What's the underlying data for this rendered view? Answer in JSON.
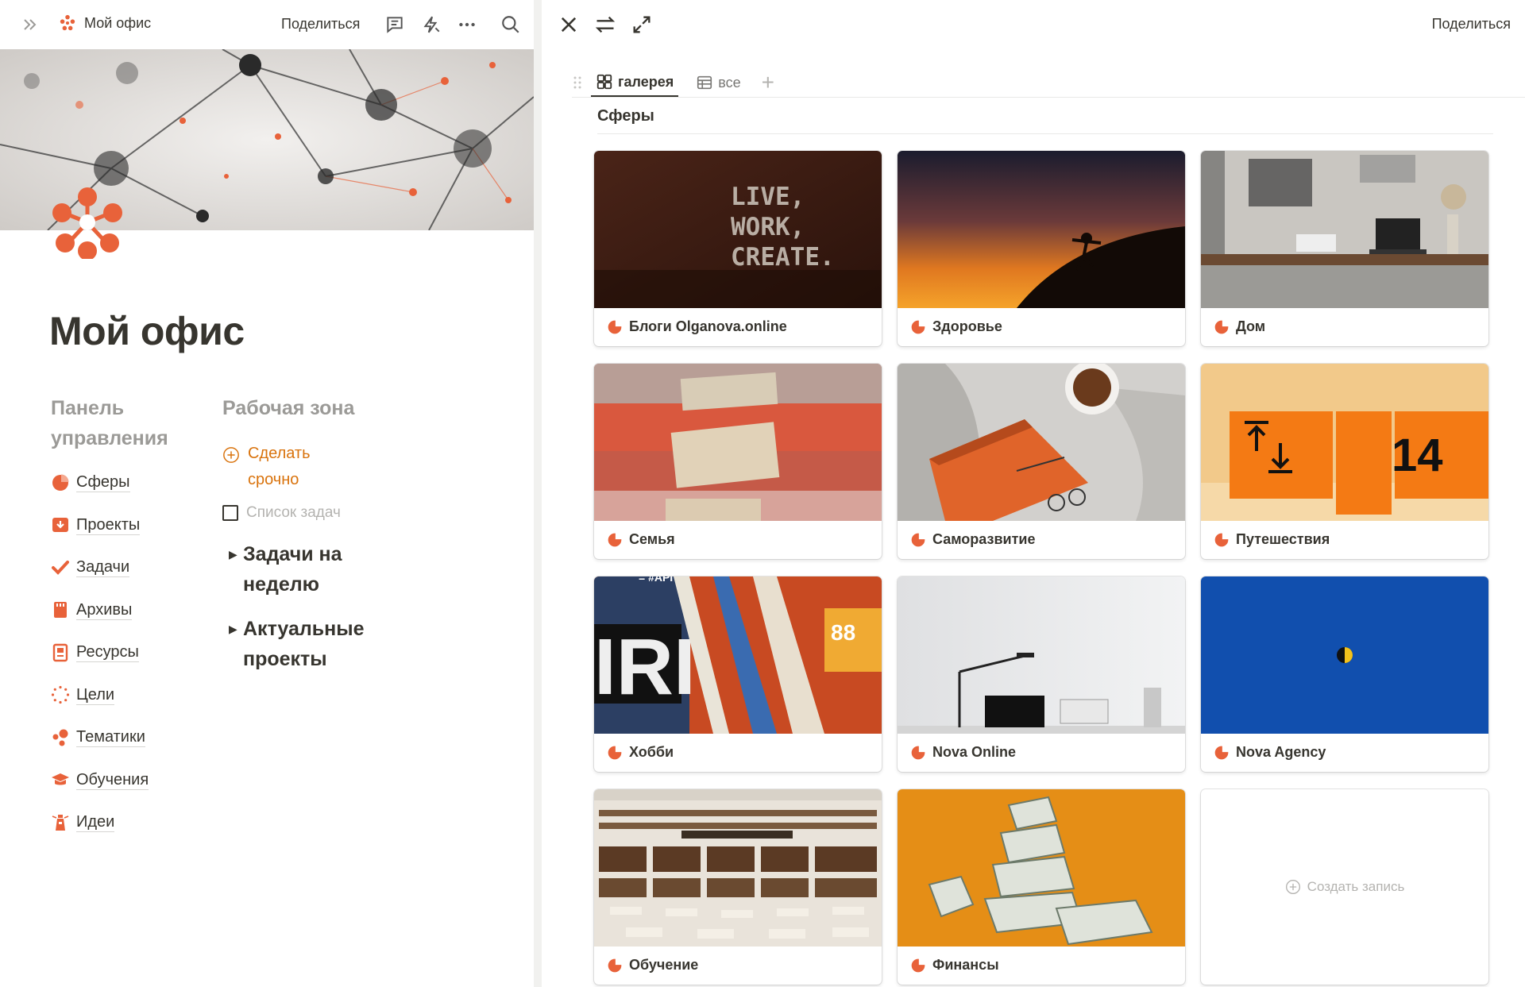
{
  "left": {
    "breadcrumb": "Мой офис",
    "share_label": "Поделиться",
    "icons": [
      "expand-sidebar-icon",
      "workspace-logo-icon",
      "comments-icon",
      "updates-icon",
      "more-icon",
      "search-icon"
    ],
    "page_title": "Мой офис",
    "panel": {
      "heading": "Панель управления",
      "items": [
        {
          "label": "Сферы",
          "icon": "pie-chart-icon"
        },
        {
          "label": "Проекты",
          "icon": "inbox-download-icon"
        },
        {
          "label": "Задачи",
          "icon": "checkmark-icon"
        },
        {
          "label": "Архивы",
          "icon": "archive-box-icon"
        },
        {
          "label": "Ресурсы",
          "icon": "book-icon"
        },
        {
          "label": "Цели",
          "icon": "target-dots-icon"
        },
        {
          "label": "Тематики",
          "icon": "molecule-icon"
        },
        {
          "label": "Обучения",
          "icon": "graduation-cap-icon"
        },
        {
          "label": "Идеи",
          "icon": "lighthouse-icon"
        }
      ]
    },
    "workzone": {
      "heading": "Рабочая зона",
      "urgent": "Сделать срочно",
      "todo": "Список задач",
      "toggles": [
        "Задачи на неделю",
        "Актуальные проекты"
      ]
    }
  },
  "right": {
    "share_label": "Поделиться",
    "icons": [
      "close-icon",
      "swap-icon",
      "fullscreen-icon"
    ],
    "views": [
      {
        "label": "галерея",
        "icon": "gallery-icon",
        "active": true
      },
      {
        "label": "все",
        "icon": "table-icon",
        "active": false
      }
    ],
    "add_view": "+",
    "db_title": "Сферы",
    "cards": [
      {
        "label": "Блоги Olganova.online",
        "image": "live-work-create-wall"
      },
      {
        "label": "Здоровье",
        "image": "sunset-yoga-silhouette"
      },
      {
        "label": "Дом",
        "image": "home-desk"
      },
      {
        "label": "Семья",
        "image": "stack-of-jeans"
      },
      {
        "label": "Саморазвитие",
        "image": "orange-notebook-coffee"
      },
      {
        "label": "Путешествия",
        "image": "orange-sign-14"
      },
      {
        "label": "Хобби",
        "image": "torn-posters"
      },
      {
        "label": "Nova Online",
        "image": "minimal-desk-lamp"
      },
      {
        "label": "Nova Agency",
        "image": "blue-moon"
      },
      {
        "label": "Обучение",
        "image": "library-hall"
      },
      {
        "label": "Финансы",
        "image": "dollar-bills-orange"
      }
    ],
    "new_record": "Создать запись",
    "image_text": {
      "live_work_create": [
        "LIVE,",
        "WORK,",
        "CREATE."
      ],
      "sign_number": "14",
      "poster_text": "88",
      "poster_hashtag": "= #API"
    }
  },
  "colors": {
    "accent": "#e8623a",
    "urgent": "#d9730d",
    "text": "#37352f",
    "muted": "#9b9a97"
  }
}
